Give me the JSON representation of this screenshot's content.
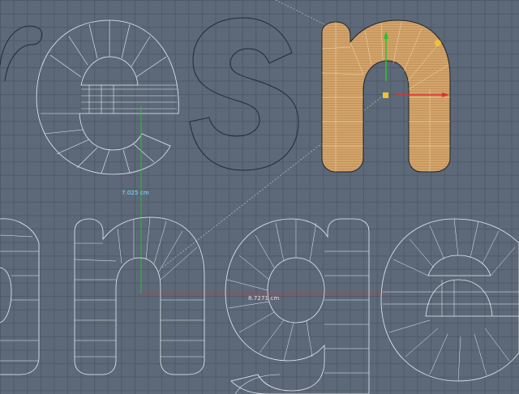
{
  "viewport": {
    "background_color": "#5d6978",
    "grid_color": "#4f5a68",
    "wireframe_color": "#ffffff",
    "selection_fill": "#d4a56a",
    "gizmo_x_color": "#e03030",
    "gizmo_y_color": "#2ec02e",
    "handle_color": "#f2c232"
  },
  "measurements": {
    "vertical": "7.025 cm",
    "horizontal": "8.7271 cm"
  }
}
